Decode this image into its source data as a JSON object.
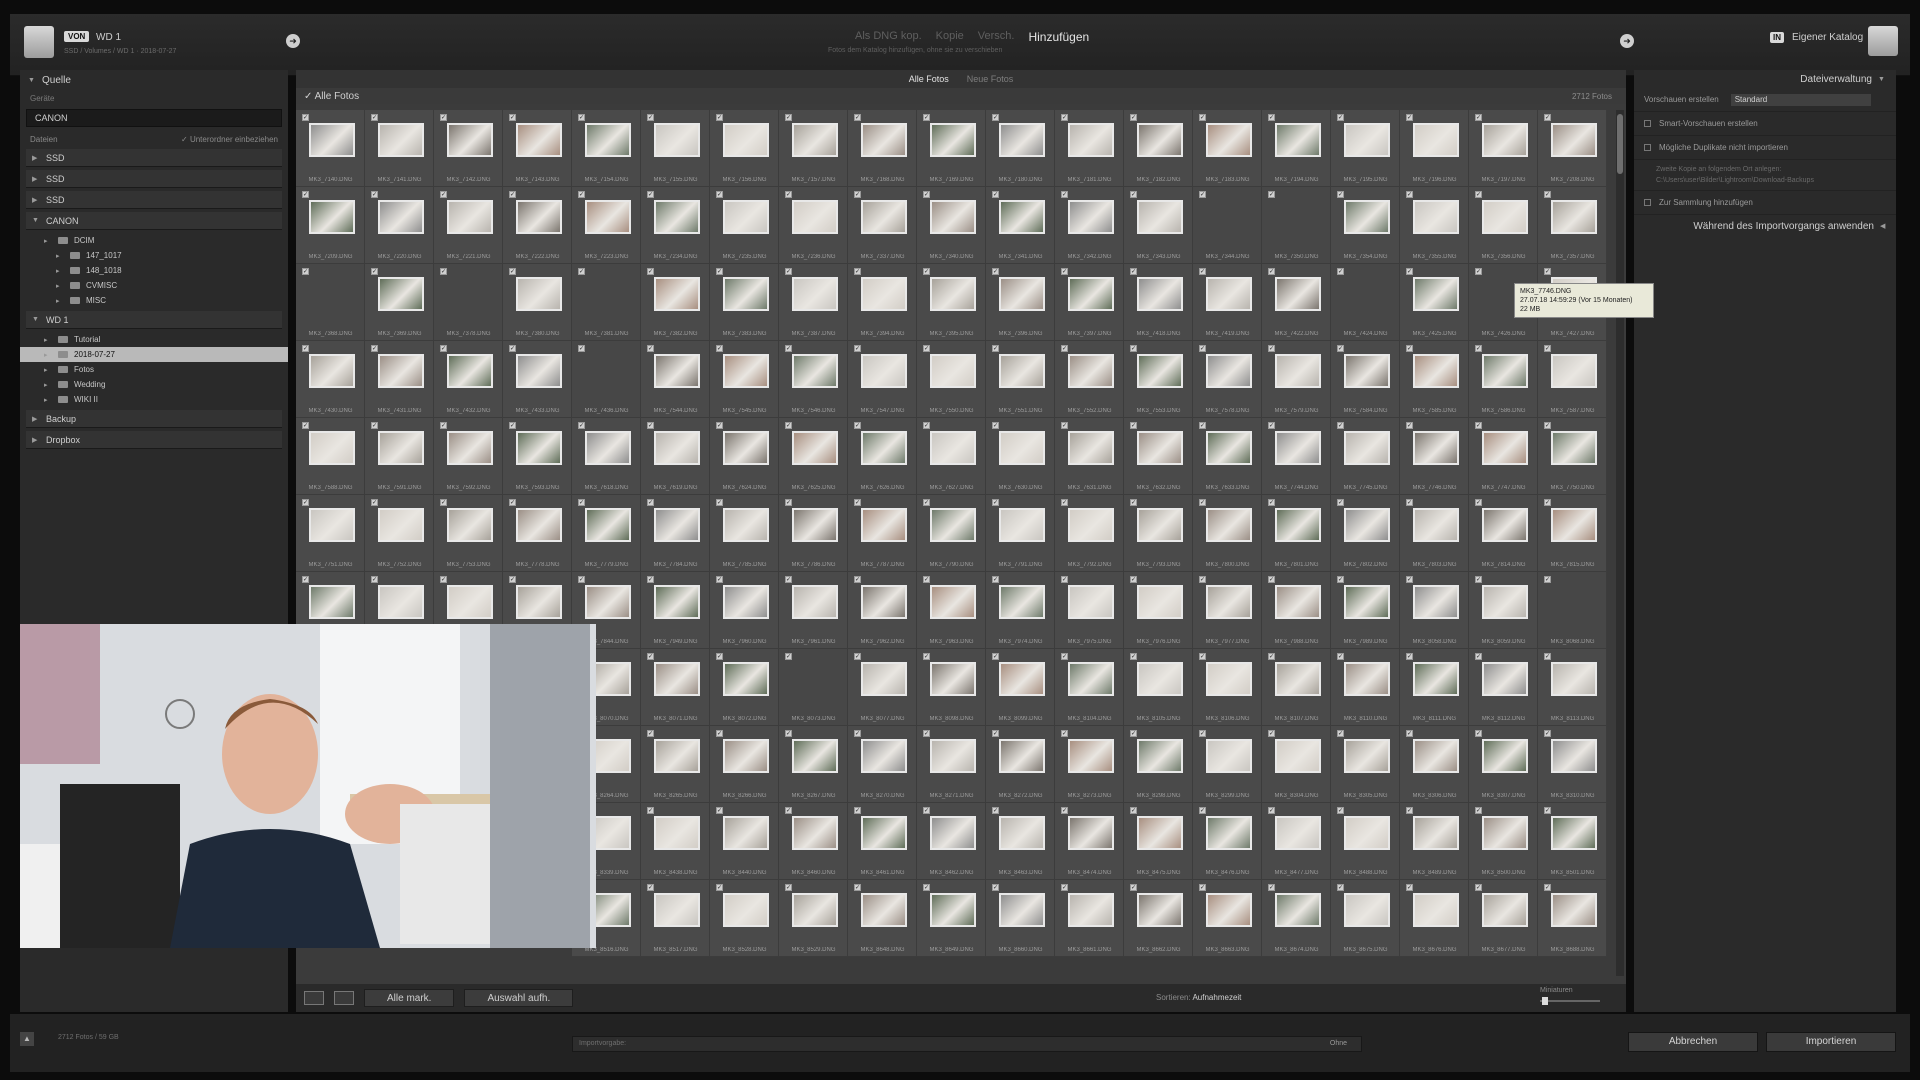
{
  "topbar": {
    "source_badge": "VON",
    "source_name": "WD 1",
    "source_path": "SSD / Volumes / WD 1 · 2018-07-27",
    "modes": [
      {
        "label": "Als DNG kop.",
        "active": false
      },
      {
        "label": "Kopie",
        "active": false
      },
      {
        "label": "Versch.",
        "active": false
      },
      {
        "label": "Hinzufügen",
        "active": true
      }
    ],
    "mode_subtitle": "Fotos dem Katalog hinzufügen, ohne sie zu verschieben",
    "dest_badge": "IN",
    "dest_name": "Eigener Katalog"
  },
  "left_panel": {
    "title": "Quelle",
    "devices_label": "Geräte",
    "device": "CANON",
    "files_label": "Dateien",
    "include_subfolders": "Unterordner einbeziehen",
    "volumes": [
      "SSD",
      "SSD",
      "SSD"
    ],
    "canon": {
      "label": "CANON",
      "folders": [
        {
          "label": "DCIM",
          "indent": 1
        },
        {
          "label": "147_1017",
          "indent": 2
        },
        {
          "label": "148_1018",
          "indent": 2
        },
        {
          "label": "CVMISC",
          "indent": 2
        },
        {
          "label": "MISC",
          "indent": 2
        }
      ]
    },
    "wd1": {
      "label": "WD 1",
      "folders": [
        {
          "label": "Tutorial",
          "indent": 1,
          "selected": false
        },
        {
          "label": "2018-07-27",
          "indent": 1,
          "selected": true
        },
        {
          "label": "Fotos",
          "indent": 1,
          "selected": false
        },
        {
          "label": "Wedding",
          "indent": 1,
          "selected": false
        },
        {
          "label": "WIKI II",
          "indent": 1,
          "selected": false
        }
      ]
    },
    "others": [
      "Backup",
      "Dropbox"
    ]
  },
  "center": {
    "filters": [
      {
        "label": "Alle Fotos",
        "active": true
      },
      {
        "label": "Neue Fotos",
        "active": false
      }
    ],
    "grid_title": "Alle Fotos",
    "grid_count": "2712 Fotos",
    "rows": [
      [
        "MK3_7140.DNG",
        "MK3_7141.DNG",
        "MK3_7142.DNG",
        "MK3_7143.DNG",
        "MK3_7154.DNG",
        "MK3_7155.DNG",
        "MK3_7156.DNG",
        "MK3_7157.DNG",
        "MK3_7168.DNG",
        "MK3_7169.DNG",
        "MK3_7180.DNG",
        "MK3_7181.DNG",
        "MK3_7182.DNG",
        "MK3_7183.DNG",
        "MK3_7194.DNG",
        "MK3_7195.DNG",
        "MK3_7196.DNG",
        "MK3_7197.DNG",
        "MK3_7208.DNG"
      ],
      [
        "MK3_7209.DNG",
        "MK3_7220.DNG",
        "MK3_7221.DNG",
        "MK3_7222.DNG",
        "MK3_7223.DNG",
        "MK3_7234.DNG",
        "MK3_7235.DNG",
        "MK3_7236.DNG",
        "MK3_7337.DNG",
        "MK3_7340.DNG",
        "MK3_7341.DNG",
        "MK3_7342.DNG",
        "MK3_7343.DNG",
        "MK3_7344.DNG",
        "MK3_7350.DNG",
        "MK3_7354.DNG",
        "MK3_7355.DNG",
        "MK3_7356.DNG",
        "MK3_7357.DNG"
      ],
      [
        "MK3_7368.DNG",
        "MK3_7369.DNG",
        "MK3_7378.DNG",
        "MK3_7380.DNG",
        "MK3_7381.DNG",
        "MK3_7382.DNG",
        "MK3_7383.DNG",
        "MK3_7387.DNG",
        "MK3_7394.DNG",
        "MK3_7395.DNG",
        "MK3_7396.DNG",
        "MK3_7397.DNG",
        "MK3_7418.DNG",
        "MK3_7419.DNG",
        "MK3_7422.DNG",
        "MK3_7424.DNG",
        "MK3_7425.DNG",
        "MK3_7426.DNG",
        "MK3_7427.DNG"
      ],
      [
        "MK3_7430.DNG",
        "MK3_7431.DNG",
        "MK3_7432.DNG",
        "MK3_7433.DNG",
        "MK3_7436.DNG",
        "MK3_7544.DNG",
        "MK3_7545.DNG",
        "MK3_7546.DNG",
        "MK3_7547.DNG",
        "MK3_7550.DNG",
        "MK3_7551.DNG",
        "MK3_7552.DNG",
        "MK3_7553.DNG",
        "MK3_7578.DNG",
        "MK3_7579.DNG",
        "MK3_7584.DNG",
        "MK3_7585.DNG",
        "MK3_7586.DNG",
        "MK3_7587.DNG"
      ],
      [
        "MK3_7588.DNG",
        "MK3_7591.DNG",
        "MK3_7592.DNG",
        "MK3_7593.DNG",
        "MK3_7618.DNG",
        "MK3_7619.DNG",
        "MK3_7624.DNG",
        "MK3_7625.DNG",
        "MK3_7626.DNG",
        "MK3_7627.DNG",
        "MK3_7630.DNG",
        "MK3_7631.DNG",
        "MK3_7632.DNG",
        "MK3_7633.DNG",
        "MK3_7744.DNG",
        "MK3_7745.DNG",
        "MK3_7746.DNG",
        "MK3_7747.DNG",
        "MK3_7750.DNG"
      ],
      [
        "MK3_7751.DNG",
        "MK3_7752.DNG",
        "MK3_7753.DNG",
        "MK3_7778.DNG",
        "MK3_7779.DNG",
        "MK3_7784.DNG",
        "MK3_7785.DNG",
        "MK3_7786.DNG",
        "MK3_7787.DNG",
        "MK3_7790.DNG",
        "MK3_7791.DNG",
        "MK3_7792.DNG",
        "MK3_7793.DNG",
        "MK3_7800.DNG",
        "MK3_7801.DNG",
        "MK3_7802.DNG",
        "MK3_7803.DNG",
        "MK3_7814.DNG",
        "MK3_7815.DNG"
      ],
      [
        "MK3_7840.DNG",
        "MK3_7841.DNG",
        "MK3_7842.DNG",
        "MK3_7843.DNG",
        "MK3_7844.DNG",
        "MK3_7949.DNG",
        "MK3_7960.DNG",
        "MK3_7961.DNG",
        "MK3_7962.DNG",
        "MK3_7963.DNG",
        "MK3_7974.DNG",
        "MK3_7975.DNG",
        "MK3_7976.DNG",
        "MK3_7977.DNG",
        "MK3_7988.DNG",
        "MK3_7989.DNG",
        "MK3_8058.DNG",
        "MK3_8059.DNG",
        "MK3_8068.DNG"
      ],
      [
        "",
        "",
        "",
        "",
        "MK3_8070.DNG",
        "MK3_8071.DNG",
        "MK3_8072.DNG",
        "MK3_8073.DNG",
        "MK3_8077.DNG",
        "MK3_8098.DNG",
        "MK3_8099.DNG",
        "MK3_8104.DNG",
        "MK3_8105.DNG",
        "MK3_8106.DNG",
        "MK3_8107.DNG",
        "MK3_8110.DNG",
        "MK3_8111.DNG",
        "MK3_8112.DNG",
        "MK3_8113.DNG"
      ],
      [
        "",
        "",
        "",
        "",
        "MK3_8264.DNG",
        "MK3_8265.DNG",
        "MK3_8266.DNG",
        "MK3_8267.DNG",
        "MK3_8270.DNG",
        "MK3_8271.DNG",
        "MK3_8272.DNG",
        "MK3_8273.DNG",
        "MK3_8298.DNG",
        "MK3_8299.DNG",
        "MK3_8304.DNG",
        "MK3_8305.DNG",
        "MK3_8306.DNG",
        "MK3_8307.DNG",
        "MK3_8310.DNG"
      ],
      [
        "",
        "",
        "",
        "",
        "MK3_8339.DNG",
        "MK3_8438.DNG",
        "MK3_8440.DNG",
        "MK3_8460.DNG",
        "MK3_8461.DNG",
        "MK3_8462.DNG",
        "MK3_8463.DNG",
        "MK3_8474.DNG",
        "MK3_8475.DNG",
        "MK3_8476.DNG",
        "MK3_8477.DNG",
        "MK3_8488.DNG",
        "MK3_8489.DNG",
        "MK3_8500.DNG",
        "MK3_8501.DNG"
      ],
      [
        "",
        "",
        "",
        "",
        "MK3_8516.DNG",
        "MK3_8517.DNG",
        "MK3_8528.DNG",
        "MK3_8529.DNG",
        "MK3_8648.DNG",
        "MK3_8649.DNG",
        "MK3_8660.DNG",
        "MK3_8661.DNG",
        "MK3_8662.DNG",
        "MK3_8663.DNG",
        "MK3_8674.DNG",
        "MK3_8675.DNG",
        "MK3_8676.DNG",
        "MK3_8677.DNG",
        "MK3_8688.DNG"
      ]
    ],
    "empty_cells": [
      "1-13",
      "1-14",
      "2-0",
      "2-2",
      "2-4",
      "2-15",
      "2-17",
      "3-4",
      "6-18",
      "7-7",
      "8-0"
    ],
    "tooltip": {
      "line1": "MK3_7746.DNG",
      "line2": "27.07.18 14:59:29 (Vor 15 Monaten)",
      "line3": "22 MB"
    },
    "toolbar": {
      "check_all": "Alle mark.",
      "uncheck_all": "Auswahl aufh.",
      "sort_label": "Sortieren:",
      "sort_value": "Aufnahmezeit",
      "thumbnail_label": "Miniaturen"
    }
  },
  "right_panel": {
    "title": "Dateiverwaltung",
    "build_previews_label": "Vorschauen erstellen",
    "build_previews_value": "Standard",
    "smart_previews": "Smart-Vorschauen erstellen",
    "no_duplicates": "Mögliche Duplikate nicht importieren",
    "second_copy": "Zweite Kopie an folgendem Ort anlegen:",
    "second_copy_path": "C:\\Users\\user\\Bilder\\Lightroom\\Download-Backups",
    "add_to_collection": "Zur Sammlung hinzufügen",
    "apply_during_import": "Während des Importvorgangs anwenden"
  },
  "footer": {
    "info": "2712 Fotos / 59 GB",
    "preset_label": "Importvorgabe:",
    "preset_value": "Ohne",
    "cancel": "Abbrechen",
    "import": "Importieren"
  },
  "webcam": {
    "description_icon": "webcam-person-icon"
  }
}
